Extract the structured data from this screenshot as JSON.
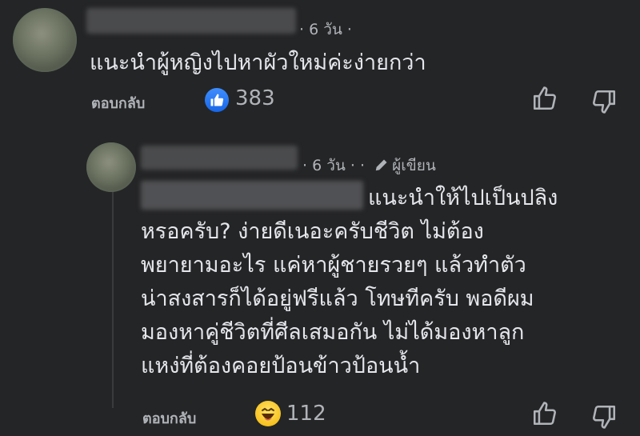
{
  "comment1": {
    "time": "· 6 วัน ·",
    "text": "แนะนำผู้หญิงไปหาผัวใหม่ค่ะง่ายกว่า",
    "reply_label": "ตอบกลับ",
    "reaction_icon": "like-icon",
    "reaction_count": "383"
  },
  "reply1": {
    "time": "· 6 วัน · ·",
    "author_tag": "ผู้เขียน",
    "lines": [
      "แนะนำให้ไปเป็นปลิง",
      "หรอครับ? ง่ายดีเนอะครับชีวิต ไม่ต้อง",
      "พยายามอะไร แค่หาผู้ชายรวยๆ แล้วทำตัว",
      "น่าสงสารก็ได้อยู่ฟรีแล้ว โทษทีครับ พอดีผม",
      "มองหาคู่ชีวิตที่ศีลเสมอกัน ไม่ได้มองหาลูก",
      "แหง่ที่ต้องคอยป้อนข้าวป้อนน้ำ"
    ],
    "reply_label": "ตอบกลับ",
    "reaction_icon": "haha-icon",
    "reaction_count": "112"
  },
  "colors": {
    "background": "#242526",
    "text": "#e4e6eb",
    "secondary": "#b0b3b8",
    "like_blue": "#1767e8"
  }
}
